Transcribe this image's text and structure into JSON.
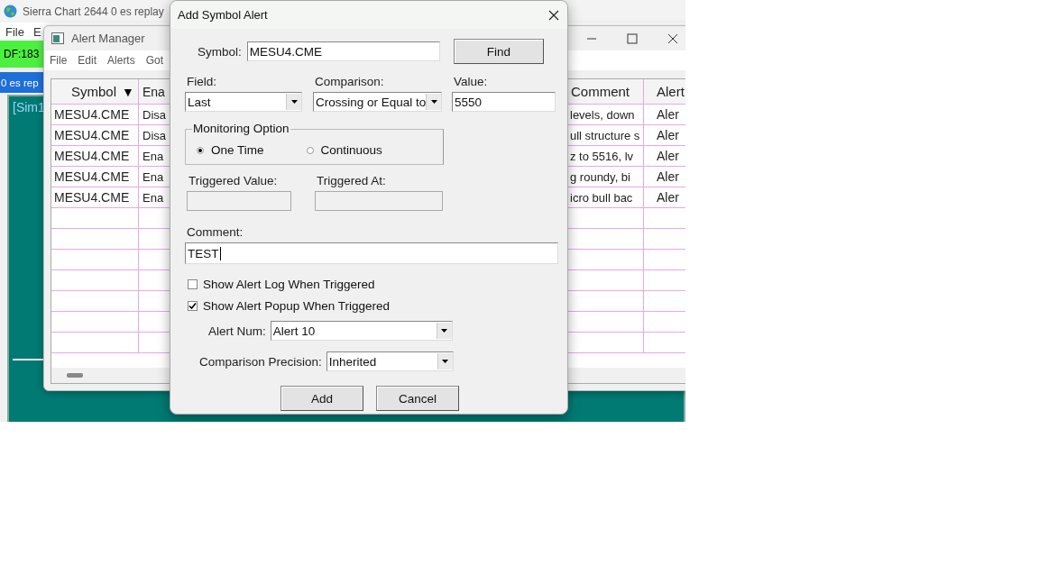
{
  "main_window": {
    "title": "Sierra Chart 2644 0 es replay",
    "menu": [
      "File",
      "E"
    ],
    "status_label": "DF:183",
    "tab_label": "0 es rep",
    "chart_label": "[Sim1"
  },
  "alert_manager": {
    "title": "Alert Manager",
    "menu": [
      "File",
      "Edit",
      "Alerts",
      "Got"
    ],
    "columns": [
      {
        "label": "Symbol",
        "sort_indicator": "▼"
      },
      {
        "label": "Ena"
      },
      {
        "label": "Comment"
      },
      {
        "label": "Alert"
      }
    ],
    "rows": [
      {
        "symbol": "MESU4.CME",
        "enabled": "Disa",
        "comment": "levels, down",
        "alert": "Aler"
      },
      {
        "symbol": "MESU4.CME",
        "enabled": "Disa",
        "comment": "ull structure s",
        "alert": "Aler"
      },
      {
        "symbol": "MESU4.CME",
        "enabled": "Ena",
        "comment": "z to 5516, lv",
        "alert": "Aler"
      },
      {
        "symbol": "MESU4.CME",
        "enabled": "Ena",
        "comment": "g roundy, bi",
        "alert": "Aler"
      },
      {
        "symbol": "MESU4.CME",
        "enabled": "Ena",
        "comment": "icro bull bac",
        "alert": "Aler"
      }
    ]
  },
  "dialog": {
    "title": "Add Symbol Alert",
    "symbol": {
      "label": "Symbol:",
      "value": "MESU4.CME"
    },
    "find_button": "Find",
    "field": {
      "label": "Field:",
      "value": "Last"
    },
    "comparison": {
      "label": "Comparison:",
      "value": "Crossing or Equal to"
    },
    "value": {
      "label": "Value:",
      "value": "5550"
    },
    "monitoring": {
      "legend": "Monitoring Option",
      "options": [
        {
          "label": "One Time",
          "selected": true
        },
        {
          "label": "Continuous",
          "selected": false
        }
      ]
    },
    "triggered_value": {
      "label": "Triggered Value:",
      "disabled": true
    },
    "triggered_at": {
      "label": "Triggered At:",
      "disabled": true
    },
    "comment": {
      "label": "Comment:",
      "value": "TEST"
    },
    "checkboxes": [
      {
        "label": "Show Alert Log When Triggered",
        "checked": false
      },
      {
        "label": "Show Alert Popup When Triggered",
        "checked": true
      }
    ],
    "alert_num": {
      "label": "Alert Num:",
      "value": "Alert 10"
    },
    "precision": {
      "label": "Comparison Precision:",
      "value": "Inherited"
    },
    "buttons": [
      "Add",
      "Cancel"
    ]
  }
}
